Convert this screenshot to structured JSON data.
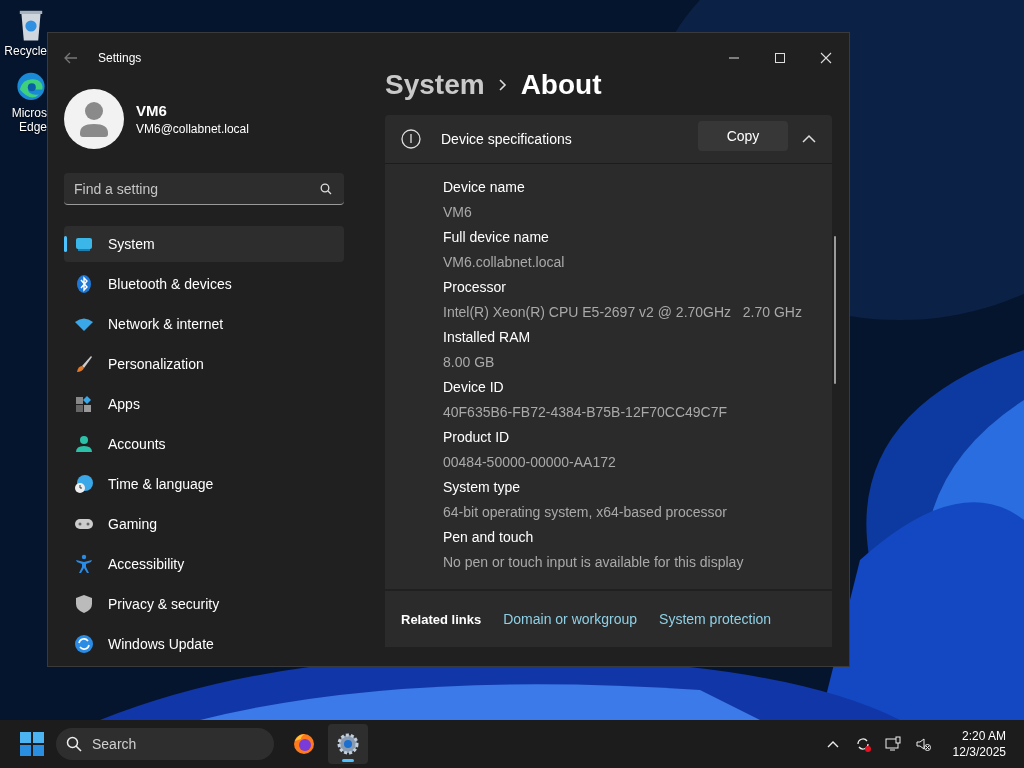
{
  "desktop": {
    "icons": [
      {
        "kind": "recycle-bin",
        "lines": [
          "Recycle"
        ]
      },
      {
        "kind": "edge",
        "lines": [
          "Micros",
          "Edge"
        ]
      }
    ]
  },
  "window": {
    "title": "Settings"
  },
  "user": {
    "name": "VM6",
    "email": "VM6@collabnet.local"
  },
  "search": {
    "placeholder": "Find a setting"
  },
  "sidebar": {
    "items": [
      {
        "kind": "system",
        "label": "System",
        "selected": true
      },
      {
        "kind": "bluetooth",
        "label": "Bluetooth & devices",
        "selected": false
      },
      {
        "kind": "network",
        "label": "Network & internet",
        "selected": false
      },
      {
        "kind": "brush",
        "label": "Personalization",
        "selected": false
      },
      {
        "kind": "apps",
        "label": "Apps",
        "selected": false
      },
      {
        "kind": "accounts",
        "label": "Accounts",
        "selected": false
      },
      {
        "kind": "time",
        "label": "Time & language",
        "selected": false
      },
      {
        "kind": "gaming",
        "label": "Gaming",
        "selected": false
      },
      {
        "kind": "accessibility",
        "label": "Accessibility",
        "selected": false
      },
      {
        "kind": "privacy",
        "label": "Privacy & security",
        "selected": false
      },
      {
        "kind": "update",
        "label": "Windows Update",
        "selected": false
      }
    ]
  },
  "breadcrumb": [
    "System",
    "About"
  ],
  "device_specifications": {
    "title": "Device specifications",
    "button": "Copy",
    "expanded": true,
    "rows": [
      {
        "label": "Device name",
        "value": "VM6"
      },
      {
        "label": "Full device name",
        "value": "VM6.collabnet.local"
      },
      {
        "label": "Processor",
        "value": "Intel(R) Xeon(R) CPU E5-2697 v2 @ 2.70GHz   2.70 GHz"
      },
      {
        "label": "Installed RAM",
        "value": "8.00 GB"
      },
      {
        "label": "Device ID",
        "value": "40F635B6-FB72-4384-B75B-12F70CC49C7F"
      },
      {
        "label": "Product ID",
        "value": "00484-50000-00000-AA172"
      },
      {
        "label": "System type",
        "value": "64-bit operating system, x64-based processor"
      },
      {
        "label": "Pen and touch",
        "value": "No pen or touch input is available for this display"
      }
    ]
  },
  "related_links": {
    "label": "Related links",
    "links": [
      "Domain or workgroup",
      "System protection"
    ]
  },
  "taskbar": {
    "search": {
      "placeholder": "Search"
    },
    "apps": [
      {
        "kind": "firefox",
        "active": false
      },
      {
        "kind": "settings",
        "active": true
      }
    ],
    "time": "2:20 AM",
    "date": "12/3/2025"
  }
}
